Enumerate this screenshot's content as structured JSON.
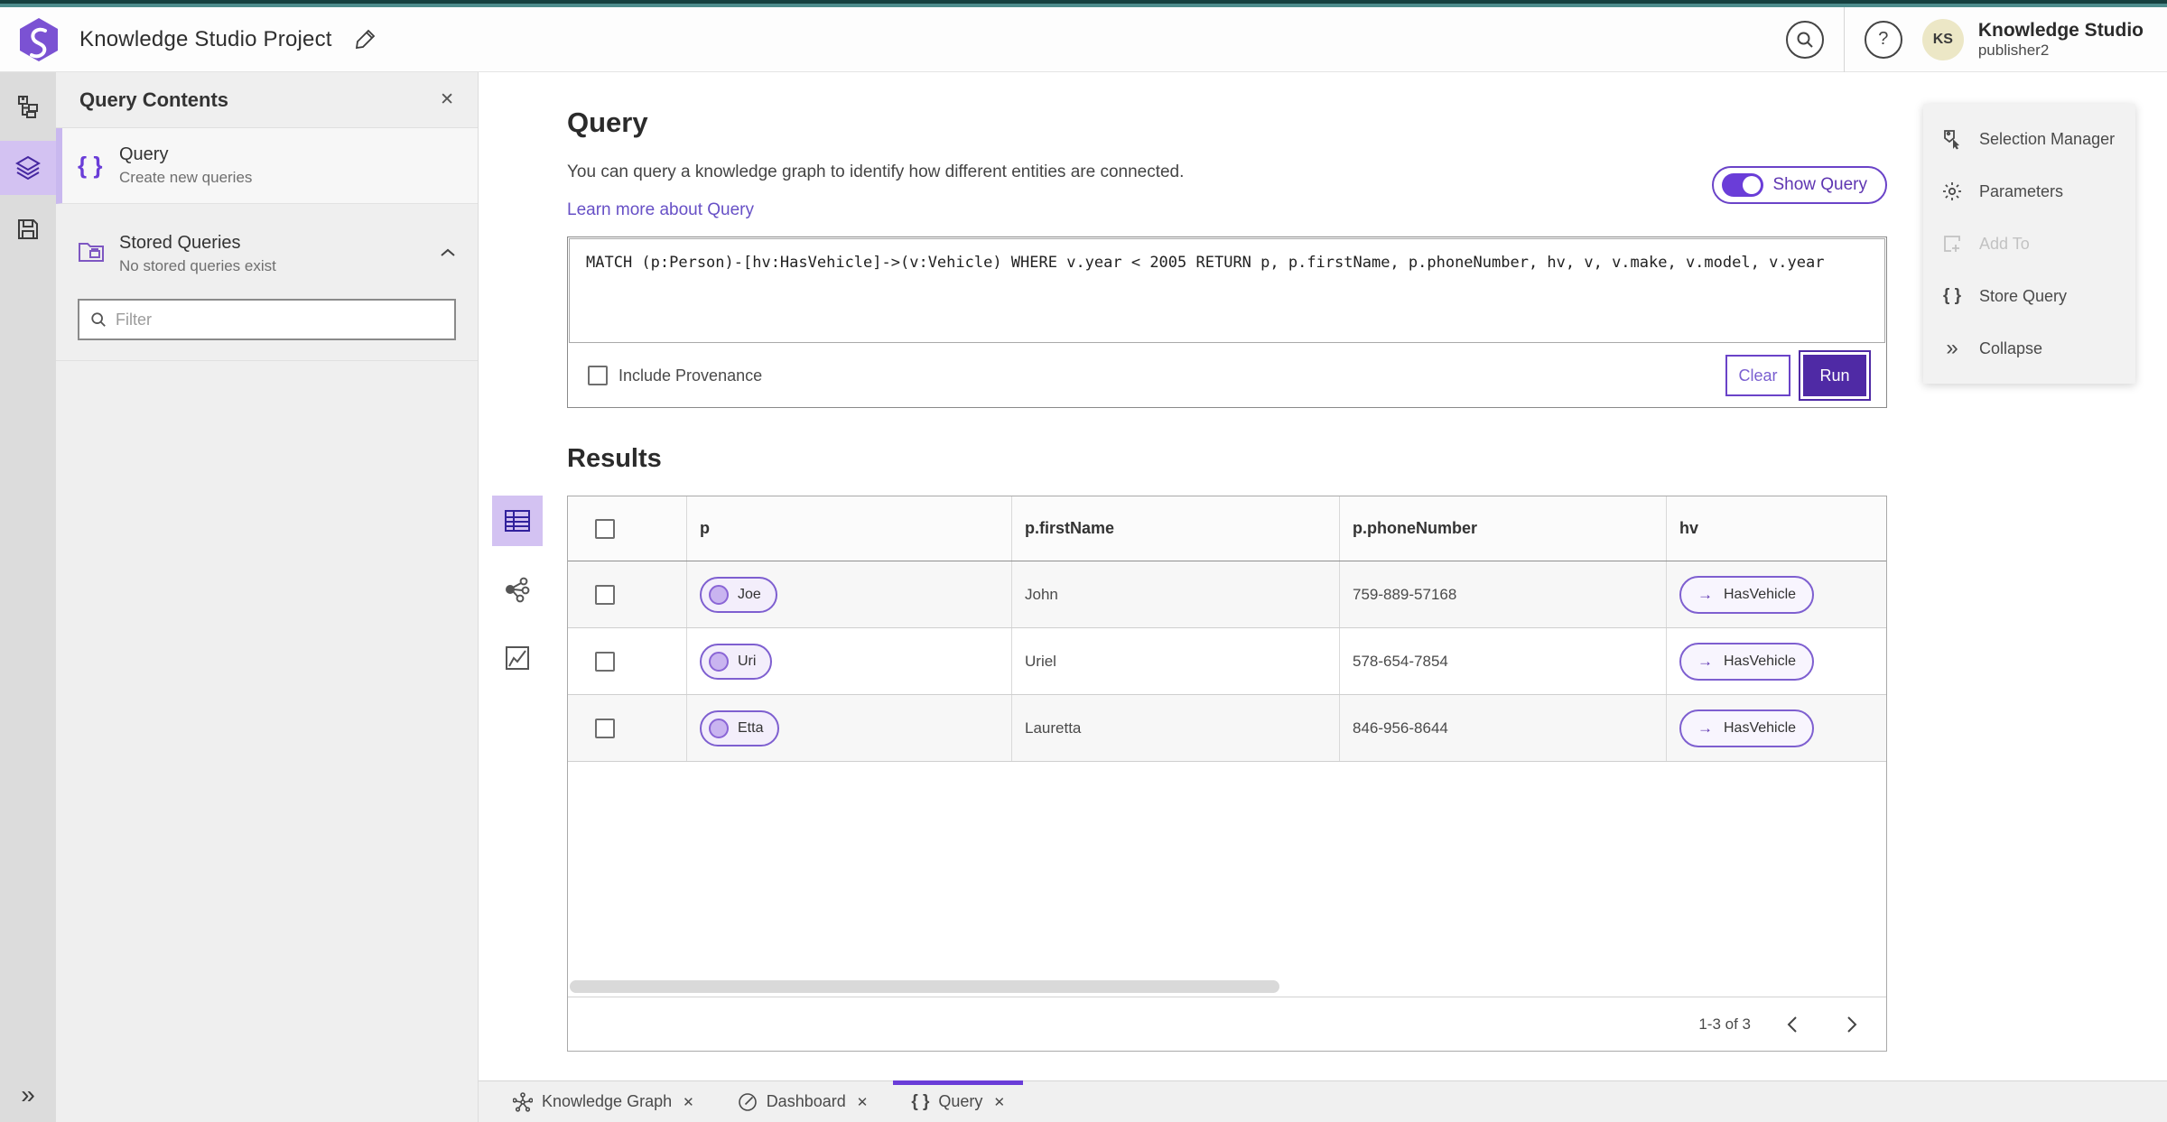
{
  "header": {
    "app_title": "Knowledge Studio Project",
    "user_name": "Knowledge Studio",
    "user_role": "publisher2",
    "avatar_initials": "KS"
  },
  "query_contents": {
    "title": "Query Contents",
    "query_item": {
      "title": "Query",
      "subtitle": "Create new queries"
    },
    "stored_queries": {
      "title": "Stored Queries",
      "subtitle": "No stored queries exist"
    },
    "filter_placeholder": "Filter"
  },
  "main": {
    "title": "Query",
    "description": "You can query a knowledge graph to identify how different entities are connected.",
    "learn_more": "Learn more about Query",
    "show_query_label": "Show Query",
    "query_text": "MATCH (p:Person)-[hv:HasVehicle]->(v:Vehicle) WHERE v.year < 2005 RETURN p, p.firstName, p.phoneNumber, hv, v, v.make, v.model, v.year",
    "include_provenance_label": "Include Provenance",
    "clear_label": "Clear",
    "run_label": "Run",
    "results_title": "Results"
  },
  "table": {
    "columns": [
      "p",
      "p.firstName",
      "p.phoneNumber",
      "hv"
    ],
    "rows": [
      {
        "p": "Joe",
        "firstName": "John",
        "phoneNumber": "759-889-57168",
        "hv": "HasVehicle"
      },
      {
        "p": "Uri",
        "firstName": "Uriel",
        "phoneNumber": "578-654-7854",
        "hv": "HasVehicle"
      },
      {
        "p": "Etta",
        "firstName": "Lauretta",
        "phoneNumber": "846-956-8644",
        "hv": "HasVehicle"
      }
    ],
    "pagination": "1-3 of 3"
  },
  "right_menu": {
    "items": [
      {
        "label": "Selection Manager",
        "disabled": false
      },
      {
        "label": "Parameters",
        "disabled": false
      },
      {
        "label": "Add To",
        "disabled": true
      },
      {
        "label": "Store Query",
        "disabled": false
      },
      {
        "label": "Collapse",
        "disabled": false
      }
    ]
  },
  "tabs": [
    {
      "label": "Knowledge Graph",
      "active": false
    },
    {
      "label": "Dashboard",
      "active": false
    },
    {
      "label": "Query",
      "active": true
    }
  ],
  "icons": {
    "braces": "{ }",
    "help": "?",
    "close": "✕",
    "collapse": "»",
    "arrow_right": "→"
  },
  "colors": {
    "accent": "#5e35b1",
    "accent_light": "#d3c2f2",
    "run_button": "#4f2aa5",
    "top_bar_teal": "#16403f"
  }
}
